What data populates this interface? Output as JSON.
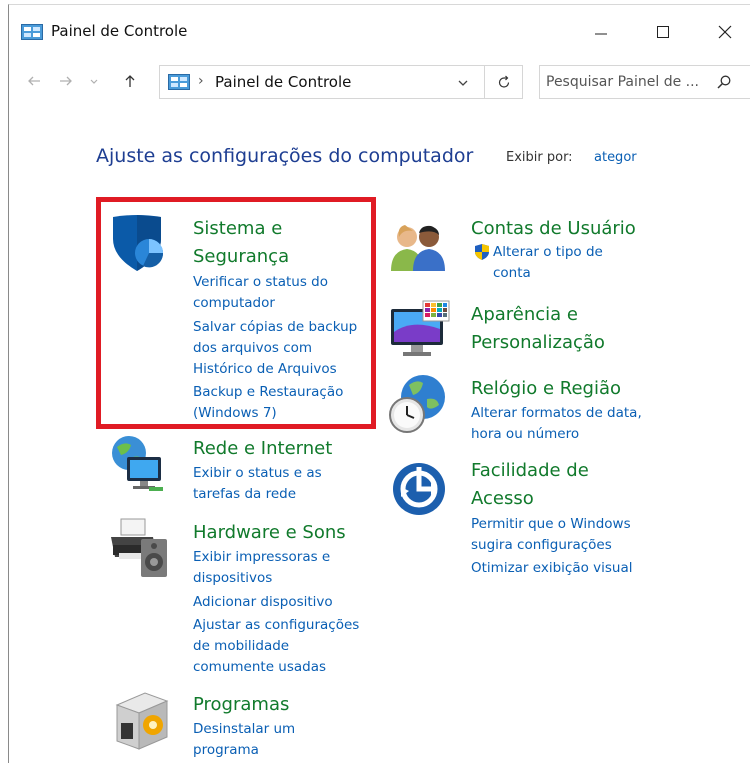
{
  "window": {
    "title": "Painel de Controle"
  },
  "address": {
    "crumb": "Painel de Controle"
  },
  "search": {
    "placeholder": "Pesquisar Painel de ..."
  },
  "header": {
    "heading": "Ajuste as configurações do computador",
    "view_by_label": "Exibir por:",
    "view_by_value": "ategor"
  },
  "categories": {
    "system": {
      "title_line1": "Sistema e",
      "title_line2": "Segurança",
      "links": [
        "Verificar o status do",
        "computador",
        "Salvar cópias de backup",
        "dos arquivos com",
        "Histórico de Arquivos",
        "Backup e Restauração",
        "(Windows 7)"
      ]
    },
    "network": {
      "title": "Rede e Internet",
      "links": [
        "Exibir o status e as",
        "tarefas da rede"
      ]
    },
    "hardware": {
      "title": "Hardware e Sons",
      "links": [
        "Exibir impressoras e",
        "dispositivos",
        "Adicionar dispositivo",
        "Ajustar as configurações",
        "de mobilidade",
        "comumente usadas"
      ]
    },
    "programs": {
      "title": "Programas",
      "links": [
        "Desinstalar um",
        "programa"
      ]
    },
    "users": {
      "title": "Contas de Usuário",
      "links": [
        "Alterar o tipo de",
        "conta"
      ]
    },
    "appearance": {
      "title_line1": "Aparência e",
      "title_line2": "Personalização"
    },
    "clock": {
      "title": "Relógio e Região",
      "links": [
        "Alterar formatos de data,",
        "hora ou número"
      ]
    },
    "access": {
      "title_line1": "Facilidade de",
      "title_line2": "Acesso",
      "links": [
        "Permitir que o Windows",
        "sugira configurações",
        "Otimizar exibição visual"
      ]
    }
  },
  "colors": {
    "category_title": "#117a2c",
    "link": "#0a5fb4",
    "heading": "#1e3e92",
    "highlight_border": "#e01b24"
  },
  "icons": [
    "control-panel-icon",
    "back-arrow-icon",
    "forward-arrow-icon",
    "recent-dropdown-icon",
    "up-arrow-icon",
    "chevron-down-icon",
    "refresh-icon",
    "search-icon",
    "minimize-icon",
    "maximize-icon",
    "close-icon",
    "shield-icon",
    "network-icon",
    "printer-icon",
    "programs-icon",
    "users-icon",
    "uac-shield-icon",
    "monitor-icon",
    "clock-globe-icon",
    "accessibility-icon"
  ]
}
